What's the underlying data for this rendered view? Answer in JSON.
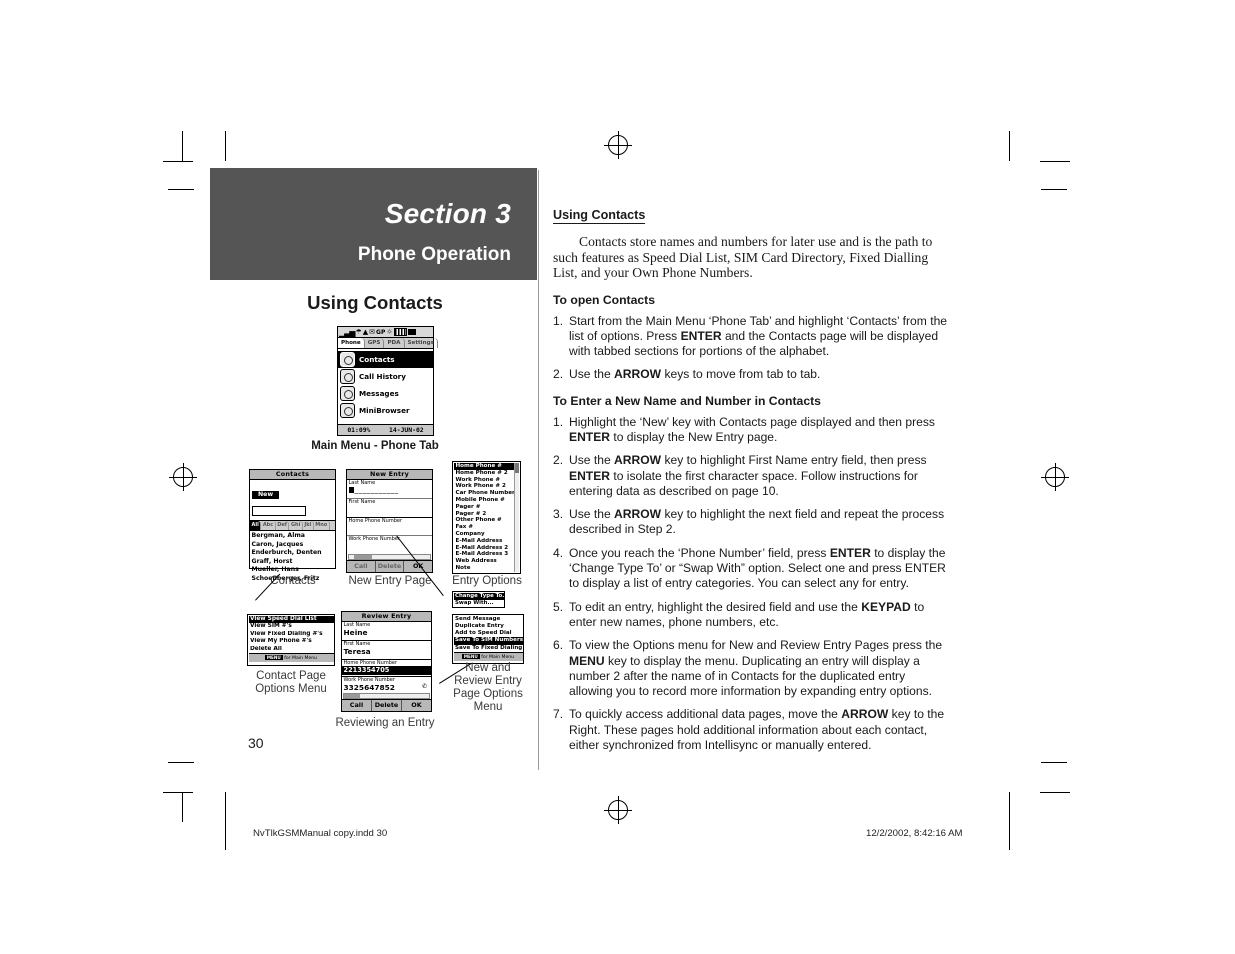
{
  "banner": {
    "section": "Section 3",
    "subtitle": "Phone Operation"
  },
  "left_column": {
    "heading": "Using Contacts",
    "main_menu_caption": "Main Menu - Phone Tab",
    "captions": {
      "contacts": "Contacts",
      "new_entry_page": "New Entry Page",
      "entry_options": "Entry Options",
      "contact_page_options_menu": "Contact Page\nOptions Menu",
      "new_and_review_entry_page_options_menu": "New and\nReview Entry\nPage Options\nMenu",
      "reviewing_an_entry": "Reviewing an Entry"
    }
  },
  "device_screens": {
    "main_menu": {
      "status_icons": [
        "signal-bars-icon",
        "roaming-icon",
        "alert-icon",
        "envelope-icon",
        "gps-icon",
        "antenna-icon",
        "battery-icon",
        "plug-icon"
      ],
      "tabs": [
        {
          "label": "Phone",
          "active": true
        },
        {
          "label": "GPS",
          "active": false
        },
        {
          "label": "PDA",
          "active": false
        },
        {
          "label": "Settings",
          "active": false
        }
      ],
      "items": [
        {
          "label": "Contacts",
          "icon": "contacts-icon",
          "selected": true
        },
        {
          "label": "Call History",
          "icon": "call-history-icon",
          "selected": false
        },
        {
          "label": "Messages",
          "icon": "messages-icon",
          "selected": false
        },
        {
          "label": "MiniBrowser",
          "icon": "minibrowser-icon",
          "selected": false
        }
      ],
      "status_left": "01:09%",
      "status_right": "14-JUN-02"
    },
    "contacts": {
      "title": "Contacts",
      "new_button": "New",
      "alpha_tabs": [
        {
          "label": "All",
          "active": true
        },
        {
          "label": "Abc",
          "active": false
        },
        {
          "label": "Def",
          "active": false
        },
        {
          "label": "Ghi",
          "active": false
        },
        {
          "label": "Jkl",
          "active": false
        },
        {
          "label": "Mno",
          "active": false
        }
      ],
      "entries": [
        "Bergman, Alma",
        "Caron, Jacques",
        "Enderburch, Denten",
        "Graff, Horst",
        "Mueller, Hans",
        "Schoenberger, Fritz"
      ]
    },
    "new_entry": {
      "title": "New Entry",
      "fields": [
        {
          "label": "Last Name",
          "value": ""
        },
        {
          "label": "First Name",
          "value": ""
        },
        {
          "label": "Home Phone Number",
          "value": ""
        },
        {
          "label": "Work Phone Number",
          "value": ""
        }
      ],
      "buttons": [
        "Call",
        "Delete",
        "OK"
      ]
    },
    "entry_options": {
      "items": [
        {
          "label": "Home Phone #",
          "selected": true
        },
        {
          "label": "Home Phone # 2",
          "selected": false
        },
        {
          "label": "Work Phone #",
          "selected": false
        },
        {
          "label": "Work Phone # 2",
          "selected": false
        },
        {
          "label": "Car Phone Number",
          "selected": false
        },
        {
          "label": "Mobile Phone #",
          "selected": false
        },
        {
          "label": "Pager #",
          "selected": false
        },
        {
          "label": "Pager # 2",
          "selected": false
        },
        {
          "label": "Other Phone #",
          "selected": false
        },
        {
          "label": "Fax #",
          "selected": false
        },
        {
          "label": "Company",
          "selected": false
        },
        {
          "label": "E-Mail Address",
          "selected": false
        },
        {
          "label": "E-Mail Address 2",
          "selected": false
        },
        {
          "label": "E-Mail Address 3",
          "selected": false
        },
        {
          "label": "Web Address",
          "selected": false
        },
        {
          "label": "Note",
          "selected": false
        }
      ]
    },
    "contact_page_options_menu": {
      "items": [
        {
          "label": "View Speed Dial List",
          "selected": true
        },
        {
          "label": "View SIM #'s",
          "selected": false
        },
        {
          "label": "View Fixed Dialing #'s",
          "selected": false
        },
        {
          "label": "View My Phone #'s",
          "selected": false
        },
        {
          "label": "Delete All",
          "selected": false
        }
      ],
      "footer_key": "MENU",
      "footer_text": "for Main Menu"
    },
    "change_type_popup": {
      "items": [
        {
          "label": "Change Type To...",
          "selected": true
        },
        {
          "label": "Swap With...",
          "selected": false
        }
      ]
    },
    "entry_options_menu": {
      "items": [
        {
          "label": "Send Message",
          "selected": false
        },
        {
          "label": "Duplicate Entry",
          "selected": false
        },
        {
          "label": "Add to Speed Dial",
          "selected": false
        },
        {
          "label": "Save To SIM Numbers",
          "selected": true
        },
        {
          "label": "Save To Fixed Dialing",
          "selected": false
        }
      ],
      "footer_key": "MENU",
      "footer_text": "for Main Menu"
    },
    "review_entry": {
      "title": "Review Entry",
      "fields": [
        {
          "label": "Last Name",
          "value": "Heine",
          "selected": false
        },
        {
          "label": "First Name",
          "value": "Teresa",
          "selected": false
        },
        {
          "label": "Home Phone Number",
          "value": "2213354705",
          "selected": true
        },
        {
          "label": "Work Phone Number",
          "value": "3325647852",
          "selected": false
        }
      ],
      "buttons": [
        "Call",
        "Delete",
        "OK"
      ]
    }
  },
  "right_column": {
    "heading": "Using Contacts",
    "intro": "Contacts store names and numbers for later use and is the path to such features as Speed Dial List, SIM Card Directory, Fixed Dialling List, and your Own Phone Numbers.",
    "sections": [
      {
        "title": "To open Contacts",
        "steps": [
          {
            "num": "1.",
            "html": "Start from the Main Menu &lsquo;Phone Tab&rsquo; and highlight &lsquo;Contacts&rsquo; from the list of options. Press <b>ENTER</b> and the Contacts page will be displayed with tabbed sections for portions of the alphabet."
          },
          {
            "num": "2.",
            "html": "Use the <b>ARROW</b> keys to move from tab to tab."
          }
        ]
      },
      {
        "title": "To Enter a New Name and Number in Contacts",
        "steps": [
          {
            "num": "1.",
            "html": "Highlight the &lsquo;New&rsquo; key with Contacts page displayed and then press <b>ENTER</b> to display the New Entry page."
          },
          {
            "num": "2.",
            "html": "Use the <b>ARROW</b> key to highlight First Name entry field, then press <b>ENTER</b> to isolate the first character space. Follow instructions for entering data as described on page 10."
          },
          {
            "num": "3.",
            "html": "Use the <b>ARROW</b> key to highlight the next field and repeat the process described in Step 2."
          },
          {
            "num": "4.",
            "html": "Once you reach the &lsquo;Phone Number&rsquo; field, press <b>ENTER</b> to display the &lsquo;Change Type To&rsquo; or &ldquo;Swap With&rdquo; option. Select one and press ENTER to display a list of entry categories. You can select any for entry."
          },
          {
            "num": "5.",
            "html": "To edit an entry, highlight the desired field and use the <b>KEYPAD</b> to enter new names, phone numbers, etc."
          },
          {
            "num": "6.",
            "html": "To view the Options menu for New and Review Entry Pages press the <b>MENU</b> key to display the menu. Duplicating an entry will display a number 2 after the name of in Contacts for the duplicated entry allowing you to record more information by expanding entry options."
          },
          {
            "num": "7.",
            "html": "To quickly access additional data pages, move the <b>ARROW</b> key to the Right. These pages hold additional information about each contact, either synchronized from Intellisync or manually entered."
          }
        ]
      }
    ]
  },
  "footer": {
    "page_number": "30",
    "file_name": "NvTlkGSMManual copy.indd   30",
    "timestamp": "12/2/2002, 8:42:16 AM"
  }
}
